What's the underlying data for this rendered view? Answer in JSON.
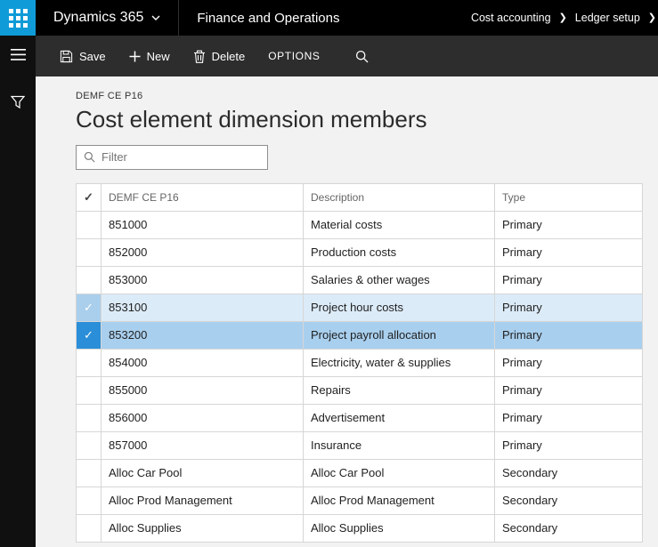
{
  "icons": {
    "check": "✓",
    "breadcrumb_chevron": "❯"
  },
  "colors": {
    "accent_blue": "#0f9bd7",
    "selected_row": "#a9cfee",
    "checked_row": "#dcebf8",
    "active_check_cell": "#2a8ed8"
  },
  "top_bar": {
    "product": "Dynamics 365",
    "app": "Finance and Operations",
    "breadcrumbs": [
      "Cost accounting",
      "Ledger setup"
    ]
  },
  "action_bar": {
    "save_label": "Save",
    "new_label": "New",
    "delete_label": "Delete",
    "options_label": "OPTIONS"
  },
  "page": {
    "record_id": "DEMF CE P16",
    "title": "Cost element dimension members",
    "filter_placeholder": "Filter"
  },
  "table": {
    "columns": [
      "DEMF CE P16",
      "Description",
      "Type"
    ],
    "rows": [
      {
        "code": "851000",
        "description": "Material costs",
        "type": "Primary",
        "state": "none"
      },
      {
        "code": "852000",
        "description": "Production costs",
        "type": "Primary",
        "state": "none"
      },
      {
        "code": "853000",
        "description": "Salaries & other wages",
        "type": "Primary",
        "state": "none"
      },
      {
        "code": "853100",
        "description": "Project hour costs",
        "type": "Primary",
        "state": "checked"
      },
      {
        "code": "853200",
        "description": "Project payroll allocation",
        "type": "Primary",
        "state": "active"
      },
      {
        "code": "854000",
        "description": "Electricity, water & supplies",
        "type": "Primary",
        "state": "none"
      },
      {
        "code": "855000",
        "description": "Repairs",
        "type": "Primary",
        "state": "none"
      },
      {
        "code": "856000",
        "description": "Advertisement",
        "type": "Primary",
        "state": "none"
      },
      {
        "code": "857000",
        "description": "Insurance",
        "type": "Primary",
        "state": "none"
      },
      {
        "code": "Alloc Car Pool",
        "description": "Alloc Car Pool",
        "type": "Secondary",
        "state": "none"
      },
      {
        "code": "Alloc Prod Management",
        "description": "Alloc Prod Management",
        "type": "Secondary",
        "state": "none"
      },
      {
        "code": "Alloc Supplies",
        "description": "Alloc Supplies",
        "type": "Secondary",
        "state": "none"
      }
    ]
  }
}
